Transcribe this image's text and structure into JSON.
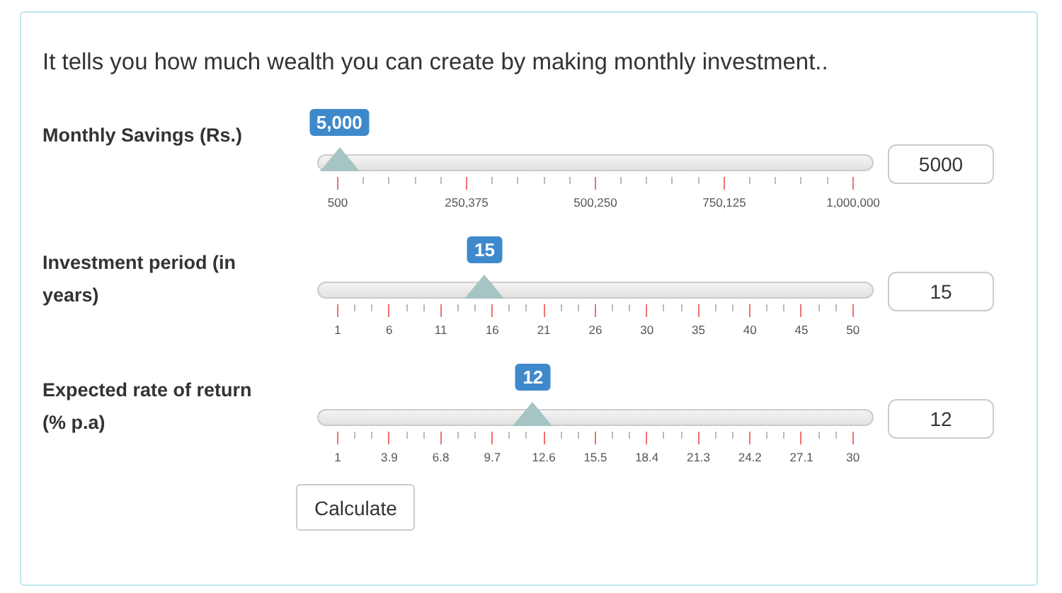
{
  "intro": "It tells you how much wealth you can create by making monthly investment..",
  "sliders": [
    {
      "label": "Monthly Savings (Rs.)",
      "bubble": "5,000",
      "level": 0.0045,
      "scale_labels": [
        "500",
        "250,375",
        "500,250",
        "750,125",
        "1,000,000"
      ],
      "value": "5000"
    },
    {
      "label": "Investment period (in years)",
      "bubble": "15",
      "level": 0.2857,
      "scale_labels": [
        "1",
        "6",
        "11",
        "16",
        "21",
        "26",
        "30",
        "35",
        "40",
        "45",
        "50"
      ],
      "value": "15"
    },
    {
      "label": "Expected rate of return (% p.a)",
      "bubble": "12",
      "level": 0.3793,
      "scale_labels": [
        "1",
        "3.9",
        "6.8",
        "9.7",
        "12.6",
        "15.5",
        "18.4",
        "21.3",
        "24.2",
        "27.1",
        "30"
      ],
      "value": "12"
    }
  ],
  "calculate_button": "Calculate"
}
